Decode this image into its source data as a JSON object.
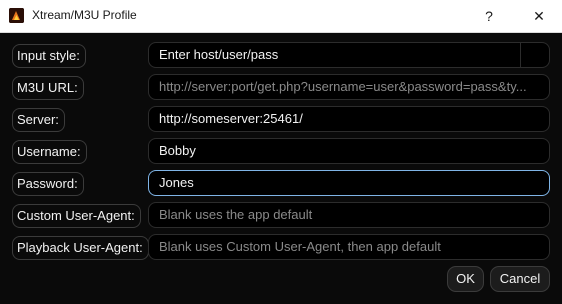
{
  "window": {
    "title": "Xtream/M3U Profile",
    "help_icon": "help-icon",
    "close_icon": "close-icon",
    "help_glyph": "?",
    "close_glyph": "✕"
  },
  "form": {
    "input_style": {
      "label": "Input style:",
      "value": "Enter host/user/pass"
    },
    "m3u_url": {
      "label": "M3U URL:",
      "placeholder": "http://server:port/get.php?username=user&password=pass&ty..."
    },
    "server": {
      "label": "Server:",
      "value": "http://someserver:25461/"
    },
    "username": {
      "label": "Username:",
      "value": "Bobby"
    },
    "password": {
      "label": "Password:",
      "value": "Jones"
    },
    "custom_user_agent": {
      "label": "Custom User-Agent:",
      "placeholder": "Blank uses the app default"
    },
    "playback_user_agent": {
      "label": "Playback User-Agent:",
      "placeholder": "Blank uses Custom User-Agent, then app default"
    }
  },
  "buttons": {
    "ok": "OK",
    "cancel": "Cancel"
  },
  "colors": {
    "background": "#0a0a0a",
    "focus_border": "#7fb4e6",
    "titlebar": "#ffffff"
  }
}
